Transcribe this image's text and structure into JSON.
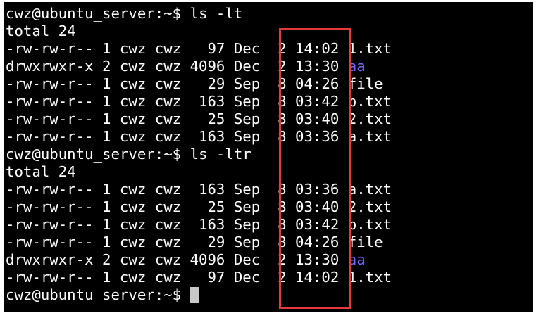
{
  "terminal": {
    "lines": [
      {
        "type": "command",
        "prompt": "cwz@ubuntu_server:~$ ",
        "command": "ls -lt"
      },
      {
        "type": "total",
        "text": "total 24"
      },
      {
        "type": "entry",
        "prefix": "-rw-rw-r-- 1 cwz cwz   97 Dec  2 14:02 ",
        "name": "1.txt",
        "is_dir": false
      },
      {
        "type": "entry",
        "prefix": "drwxrwxr-x 2 cwz cwz 4096 Dec  2 13:30 ",
        "name": "aa",
        "is_dir": true
      },
      {
        "type": "entry",
        "prefix": "-rw-rw-r-- 1 cwz cwz   29 Sep  8 04:26 ",
        "name": "file",
        "is_dir": false
      },
      {
        "type": "entry",
        "prefix": "-rw-rw-r-- 1 cwz cwz  163 Sep  8 03:42 ",
        "name": "b.txt",
        "is_dir": false
      },
      {
        "type": "entry",
        "prefix": "-rw-rw-r-- 1 cwz cwz   25 Sep  8 03:40 ",
        "name": "2.txt",
        "is_dir": false
      },
      {
        "type": "entry",
        "prefix": "-rw-rw-r-- 1 cwz cwz  163 Sep  8 03:36 ",
        "name": "a.txt",
        "is_dir": false
      },
      {
        "type": "command",
        "prompt": "cwz@ubuntu_server:~$ ",
        "command": "ls -ltr"
      },
      {
        "type": "total",
        "text": "total 24"
      },
      {
        "type": "entry",
        "prefix": "-rw-rw-r-- 1 cwz cwz  163 Sep  8 03:36 ",
        "name": "a.txt",
        "is_dir": false
      },
      {
        "type": "entry",
        "prefix": "-rw-rw-r-- 1 cwz cwz   25 Sep  8 03:40 ",
        "name": "2.txt",
        "is_dir": false
      },
      {
        "type": "entry",
        "prefix": "-rw-rw-r-- 1 cwz cwz  163 Sep  8 03:42 ",
        "name": "b.txt",
        "is_dir": false
      },
      {
        "type": "entry",
        "prefix": "-rw-rw-r-- 1 cwz cwz   29 Sep  8 04:26 ",
        "name": "file",
        "is_dir": false
      },
      {
        "type": "entry",
        "prefix": "drwxrwxr-x 2 cwz cwz 4096 Dec  2 13:30 ",
        "name": "aa",
        "is_dir": true
      },
      {
        "type": "entry",
        "prefix": "-rw-rw-r-- 1 cwz cwz   97 Dec  2 14:02 ",
        "name": "1.txt",
        "is_dir": false
      },
      {
        "type": "prompt",
        "prompt": "cwz@ubuntu_server:~$ "
      }
    ]
  },
  "colors": {
    "background": "#000000",
    "foreground": "#ffffff",
    "directory": "#6c6cff",
    "cursor": "#c8c8c8",
    "highlight_box": "#e53a3a"
  }
}
